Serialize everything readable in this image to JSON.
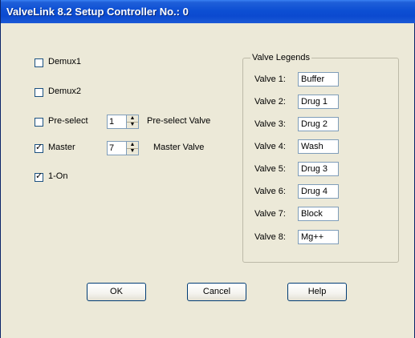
{
  "window": {
    "title": "ValveLink 8.2 Setup Controller No.: 0"
  },
  "options": {
    "demux1": {
      "label": "Demux1",
      "checked": false
    },
    "demux2": {
      "label": "Demux2",
      "checked": false
    },
    "preselect": {
      "label": "Pre-select",
      "checked": false,
      "spin_value": "1",
      "spin_label": "Pre-select Valve"
    },
    "master": {
      "label": "Master",
      "checked": true,
      "spin_value": "7",
      "spin_label": "Master Valve"
    },
    "one_on": {
      "label": "1-On",
      "checked": true
    }
  },
  "check_mark": "✓",
  "legends": {
    "title": "Valve Legends",
    "valves": [
      {
        "label": "Valve 1:",
        "value": "Buffer"
      },
      {
        "label": "Valve 2:",
        "value": "Drug 1"
      },
      {
        "label": "Valve 3:",
        "value": "Drug 2"
      },
      {
        "label": "Valve 4:",
        "value": "Wash"
      },
      {
        "label": "Valve 5:",
        "value": "Drug 3"
      },
      {
        "label": "Valve 6:",
        "value": "Drug 4"
      },
      {
        "label": "Valve 7:",
        "value": "Block"
      },
      {
        "label": "Valve 8:",
        "value": "Mg++"
      }
    ]
  },
  "buttons": {
    "ok": "OK",
    "cancel": "Cancel",
    "help": "Help"
  },
  "colors": {
    "titlebar": "#0b4ad0",
    "dialog_bg": "#ece9d8",
    "field_border": "#7f9db9"
  }
}
